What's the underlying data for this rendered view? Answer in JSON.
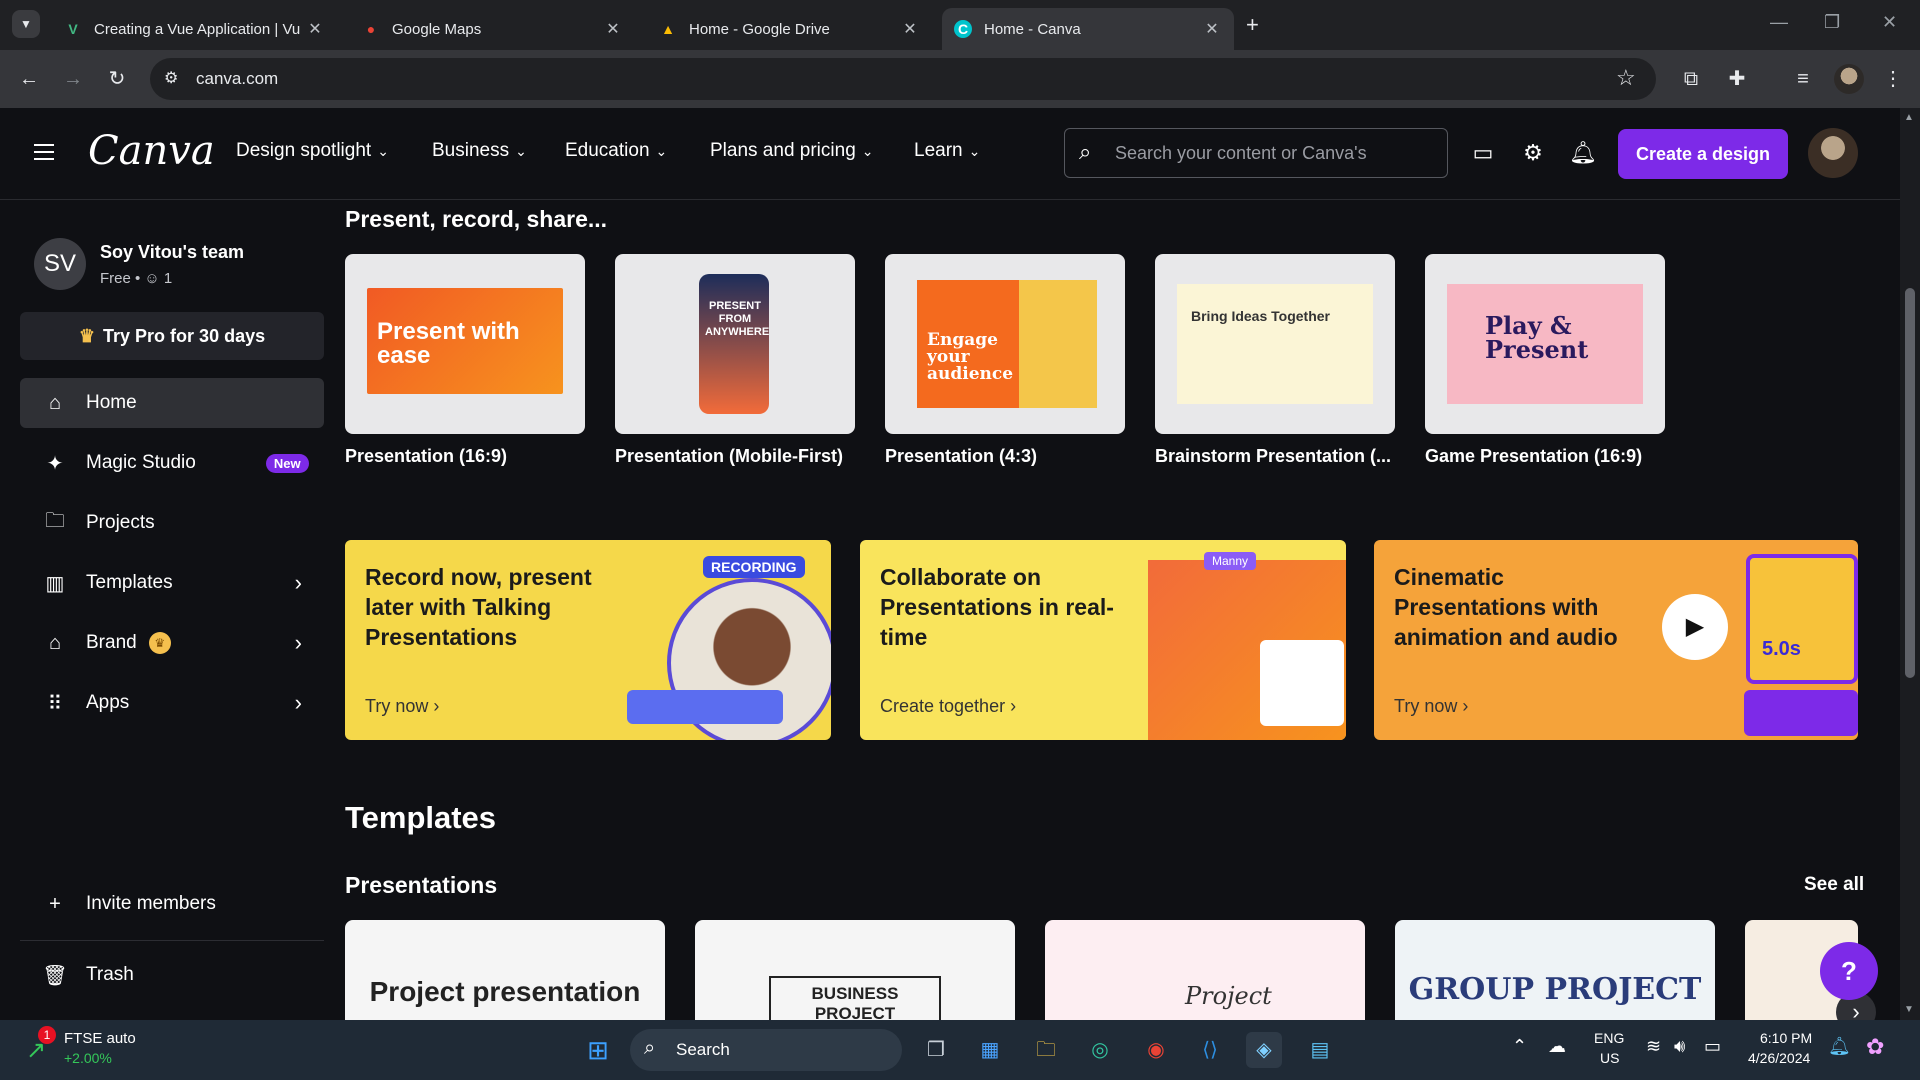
{
  "browser": {
    "tabs": [
      {
        "title": "Creating a Vue Application | Vu",
        "icon": "vue-icon"
      },
      {
        "title": "Google Maps",
        "icon": "maps-icon"
      },
      {
        "title": "Home - Google Drive",
        "icon": "drive-icon"
      },
      {
        "title": "Home - Canva",
        "icon": "canva-icon"
      }
    ],
    "url": "canva.com"
  },
  "header": {
    "logo": "Canva",
    "nav": [
      "Design spotlight",
      "Business",
      "Education",
      "Plans and pricing",
      "Learn"
    ],
    "search_placeholder": "Search your content or Canva's",
    "create_label": "Create a design"
  },
  "sidebar": {
    "team_initials": "SV",
    "team_name": "Soy Vitou's team",
    "team_meta": "Free • ☺ 1",
    "try_pro": "Try Pro for 30 days",
    "items": [
      {
        "label": "Home"
      },
      {
        "label": "Magic Studio",
        "badge": "New"
      },
      {
        "label": "Projects"
      },
      {
        "label": "Templates"
      },
      {
        "label": "Brand"
      },
      {
        "label": "Apps"
      }
    ],
    "invite": "Invite members",
    "trash": "Trash"
  },
  "main": {
    "present_title": "Present, record, share...",
    "cards": [
      {
        "label": "Presentation (16:9)",
        "thumb_text": "Present with ease"
      },
      {
        "label": "Presentation (Mobile-First)",
        "thumb_text": "PRESENT FROM ANYWHERE"
      },
      {
        "label": "Presentation (4:3)",
        "thumb_text": "Engage your audience"
      },
      {
        "label": "Brainstorm Presentation (...",
        "thumb_text": "Bring Ideas Together"
      },
      {
        "label": "Game Presentation (16:9)",
        "thumb_text": "Play & Present"
      }
    ],
    "promos": [
      {
        "title": "Record now, present later with Talking Presentations",
        "link": "Try now",
        "tag": "RECORDING"
      },
      {
        "title": "Collaborate on Presentations in real-time",
        "link": "Create together",
        "tag": "Manny"
      },
      {
        "title": "Cinematic Presentations with animation and audio",
        "link": "Try now",
        "tag": "5.0s"
      }
    ],
    "templates_title": "Templates",
    "presentations_title": "Presentations",
    "see_all": "See all",
    "template_thumbs": [
      "Project presentation",
      "BUSINESS PROJECT",
      "Project",
      "GROUP PROJECT",
      ""
    ]
  },
  "taskbar": {
    "stock_name": "FTSE auto",
    "stock_change": "+2.00%",
    "notif_count": "1",
    "search": "Search",
    "lang1": "ENG",
    "lang2": "US",
    "time": "6:10 PM",
    "date": "4/26/2024"
  },
  "colors": {
    "accent": "#7d2ae8",
    "bg": "#0f1014",
    "promo_yellow": "#f5d84a",
    "promo_orange": "#f5a33a"
  }
}
